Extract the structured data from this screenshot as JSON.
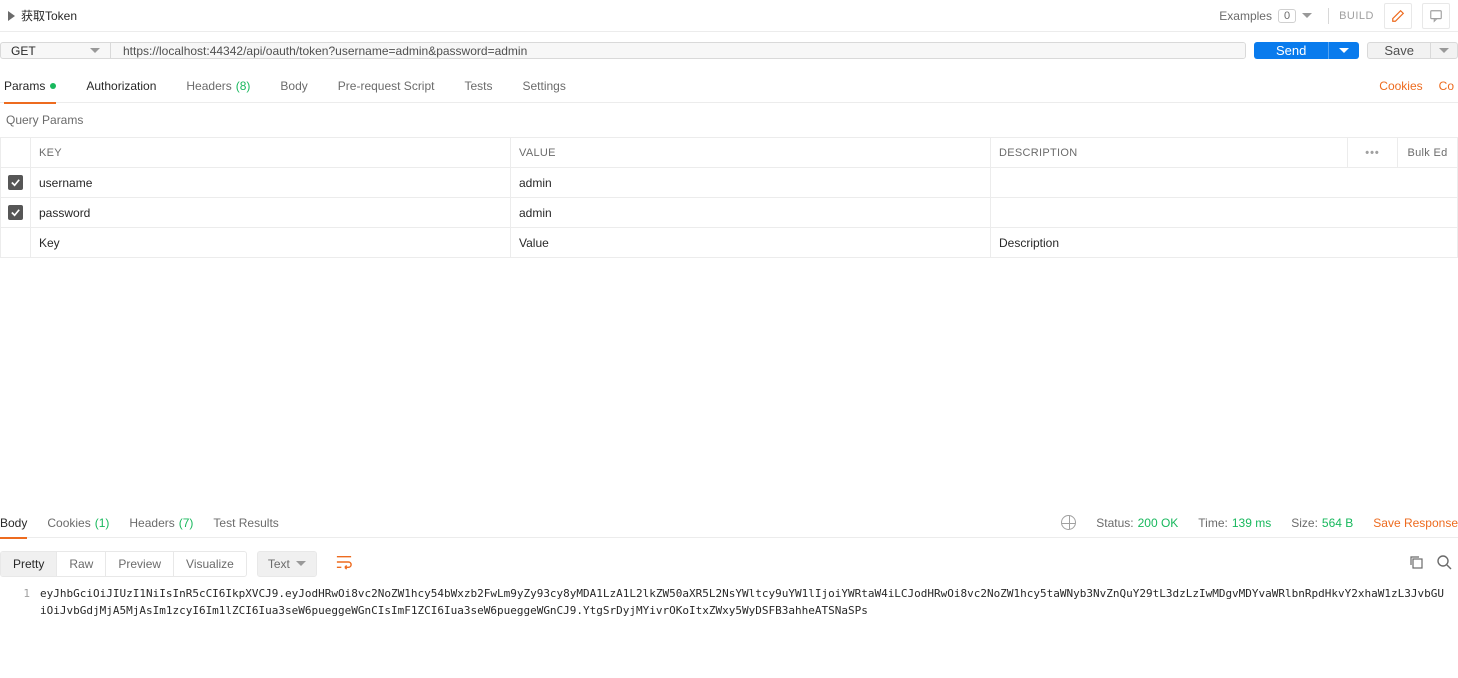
{
  "header": {
    "request_name": "获取Token",
    "examples_label": "Examples",
    "examples_count": "0",
    "build_label": "BUILD"
  },
  "request": {
    "method": "GET",
    "url": "https://localhost:44342/api/oauth/token?username=admin&password=admin",
    "send_label": "Send",
    "save_label": "Save"
  },
  "request_tabs": {
    "params": "Params",
    "authorization": "Authorization",
    "headers": "Headers",
    "headers_count": "(8)",
    "body": "Body",
    "prerequest": "Pre-request Script",
    "tests": "Tests",
    "settings": "Settings",
    "cookies_link": "Cookies",
    "code_link": "Co"
  },
  "query_params": {
    "section_title": "Query Params",
    "columns": {
      "key": "KEY",
      "value": "VALUE",
      "description": "DESCRIPTION"
    },
    "bulk_edit_label": "Bulk Ed",
    "rows": [
      {
        "key": "username",
        "value": "admin",
        "description": ""
      },
      {
        "key": "password",
        "value": "admin",
        "description": ""
      }
    ],
    "placeholders": {
      "key": "Key",
      "value": "Value",
      "description": "Description"
    }
  },
  "response_tabs": {
    "body": "Body",
    "cookies": "Cookies",
    "cookies_count": "(1)",
    "headers": "Headers",
    "headers_count": "(7)",
    "test_results": "Test Results"
  },
  "response_stats": {
    "status_label": "Status:",
    "status_value": "200 OK",
    "time_label": "Time:",
    "time_value": "139 ms",
    "size_label": "Size:",
    "size_value": "564 B",
    "save_response": "Save Response"
  },
  "body_view": {
    "tabs": {
      "pretty": "Pretty",
      "raw": "Raw",
      "preview": "Preview",
      "visualize": "Visualize"
    },
    "format": "Text",
    "line_no": "1",
    "content": "eyJhbGciOiJIUzI1NiIsInR5cCI6IkpXVCJ9.eyJodHRwOi8vc2NoZW1hcy54bWxzb2FwLm9yZy93cy8yMDA1LzA1L2lkZW50aXR5L2NsYWltcy9uYW1lIjoiYWRtaW4iLCJodHRwOi8vc2NoZW1hcy5taWNyb3NvZnQuY29tL3dzLzIwMDgvMDYvaWRlbnRpdHkvY2xhaW1zL3JvbGUiOiJvbGdjMjA5MjAsIm1zcyI6Im1lZCI6Iua3seW6pueggeWGnCIsImF1ZCI6Iua3seW6pueggeWGnCJ9.YtgSrDyjMYivrOKoItxZWxy5WyDSFB3ahheATSNaSPs"
  }
}
